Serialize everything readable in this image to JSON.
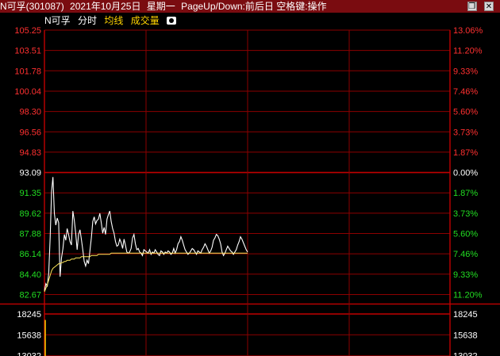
{
  "title_bar": {
    "stock": "N可孚(301087)",
    "date": "2021年10月25日",
    "weekday": "星期一",
    "hint": "PageUp/Down:前后日 空格键:操作"
  },
  "toolbar": {
    "symbol": "N可孚",
    "tab_fenshi": "分时",
    "tab_junxian": "均线",
    "tab_volume": "成交量",
    "camera_icon": "camera-icon"
  },
  "colors": {
    "background": "#000000",
    "title_bg": "#7a0c10",
    "grid": "#8c0000",
    "up_label": "#ff3030",
    "down_label": "#22dd22",
    "neutral_label": "#ffffff",
    "price_line": "#ffffff",
    "avg_line": "#ffe85a"
  },
  "chart_data": {
    "type": "line",
    "price_axis": {
      "left_ticks": [
        "105.25",
        "103.51",
        "101.78",
        "100.04",
        "98.30",
        "96.56",
        "94.83",
        "93.09",
        "91.35",
        "89.62",
        "87.88",
        "86.14",
        "84.40",
        "82.67"
      ],
      "right_ticks": [
        "13.06%",
        "11.20%",
        "9.33%",
        "7.46%",
        "5.60%",
        "3.73%",
        "1.87%",
        "0.00%",
        "1.87%",
        "3.73%",
        "5.60%",
        "7.46%",
        "9.33%",
        "11.20%"
      ],
      "ylim": [
        82.67,
        105.25
      ],
      "prev_close": 93.09
    },
    "volume_axis": {
      "left_ticks": [
        "18245",
        "15638",
        "13032"
      ],
      "right_ticks": [
        "18245",
        "15638",
        "13032"
      ]
    },
    "series": [
      {
        "values": [
          83.0,
          83.6,
          83.4,
          84.5,
          87.5,
          91.5,
          92.7,
          89.6,
          88.6,
          89.2,
          88.8,
          84.2,
          85.8,
          86.6,
          87.8,
          87.3,
          88.3,
          87.8,
          87.2,
          86.9,
          89.8,
          89.0,
          87.9,
          86.5,
          87.8,
          88.2,
          87.4,
          86.5,
          85.5,
          85.1,
          85.6,
          85.3,
          86.4,
          87.5,
          88.9,
          89.3,
          88.7,
          89.0,
          89.1,
          89.6,
          88.8,
          87.9,
          88.4,
          87.8,
          89.1,
          89.5,
          89.8,
          88.9,
          88.3,
          87.9,
          87.2,
          86.8,
          86.9,
          87.4,
          87.1,
          86.6,
          87.4,
          86.9,
          86.3,
          86.2,
          86.3,
          86.6,
          87.5,
          87.8,
          87.0,
          86.5,
          86.6,
          86.3,
          86.2,
          86.0,
          86.5,
          86.4,
          86.3,
          86.2,
          86.5,
          86.1,
          86.3,
          86.2,
          86.5,
          86.3,
          86.1,
          86.0,
          86.4,
          86.3,
          86.1,
          86.3,
          86.2,
          86.4,
          86.3,
          86.1,
          86.2,
          86.6,
          86.2,
          86.5,
          87.0,
          87.2,
          87.6,
          87.3,
          86.9,
          86.5,
          86.3,
          86.1,
          86.2,
          86.4,
          86.6,
          86.5,
          86.3,
          86.1,
          86.4,
          86.3,
          86.2,
          86.5,
          86.7,
          87.0,
          86.8,
          86.5,
          86.2,
          86.4,
          86.7,
          87.3,
          87.5,
          87.8,
          87.7,
          87.4,
          87.0,
          86.3,
          86.0,
          86.2,
          86.5,
          86.8,
          86.6,
          86.4,
          86.3,
          86.1,
          86.3,
          86.5,
          86.9,
          87.2,
          87.6,
          87.4,
          87.1,
          86.8,
          86.5,
          86.3
        ]
      },
      {
        "values": [
          82.9,
          83.2,
          83.5,
          83.9,
          84.3,
          84.7,
          84.9,
          85.0,
          85.1,
          85.2,
          85.3,
          85.3,
          85.4,
          85.4,
          85.5,
          85.5,
          85.6,
          85.6,
          85.6,
          85.7,
          85.7,
          85.7,
          85.8,
          85.8,
          85.8,
          85.8,
          85.9,
          85.9,
          85.9,
          85.9,
          85.9,
          85.9,
          85.9,
          86.0,
          86.0,
          86.0,
          86.0,
          86.0,
          86.1,
          86.1,
          86.1,
          86.1,
          86.1,
          86.1,
          86.1,
          86.1,
          86.1,
          86.2,
          86.2,
          86.2,
          86.2,
          86.2,
          86.2,
          86.2,
          86.2,
          86.2,
          86.2,
          86.2,
          86.2,
          86.2,
          86.2,
          86.2,
          86.2,
          86.2,
          86.2,
          86.2,
          86.2,
          86.2,
          86.2,
          86.2,
          86.2,
          86.2,
          86.2,
          86.2,
          86.2,
          86.2,
          86.2,
          86.2,
          86.2,
          86.2,
          86.2,
          86.2,
          86.2,
          86.2,
          86.2,
          86.2,
          86.2,
          86.2,
          86.2,
          86.2,
          86.2,
          86.2,
          86.2,
          86.2,
          86.2,
          86.2,
          86.2,
          86.2,
          86.2,
          86.2,
          86.2,
          86.2,
          86.2,
          86.2,
          86.2,
          86.2,
          86.2,
          86.2,
          86.2,
          86.2,
          86.2,
          86.2,
          86.2,
          86.2,
          86.2,
          86.2,
          86.2,
          86.2,
          86.2,
          86.2,
          86.2,
          86.2,
          86.2,
          86.2,
          86.2,
          86.2,
          86.2,
          86.2,
          86.2,
          86.2,
          86.2,
          86.2,
          86.2,
          86.2,
          86.2,
          86.2,
          86.2,
          86.2,
          86.2,
          86.2,
          86.2,
          86.2,
          86.2,
          86.2
        ]
      }
    ],
    "volume": [
      17500
    ]
  }
}
